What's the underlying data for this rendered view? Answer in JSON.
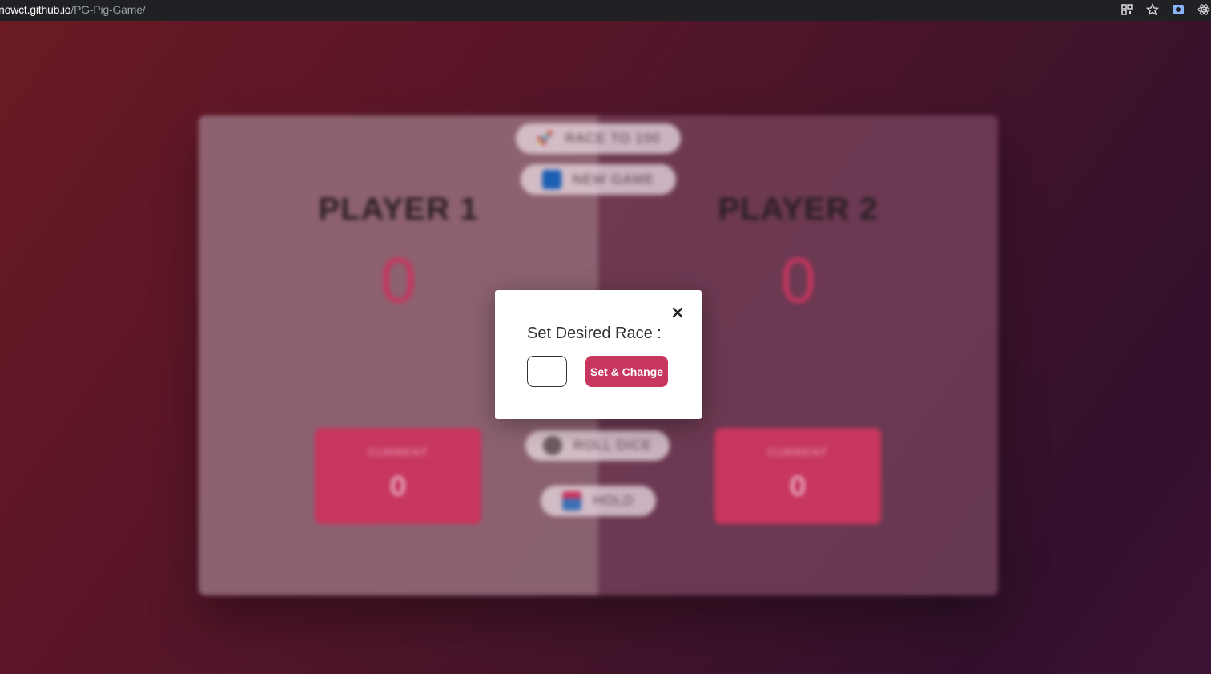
{
  "browser": {
    "url_host": "nowct.github.io",
    "url_path": "/PG-Pig-Game/",
    "icons": [
      "qr-code-icon",
      "bookmark-star-icon",
      "screen-capture-icon",
      "react-devtools-icon"
    ]
  },
  "game": {
    "race_button_label": "RACE TO 100",
    "new_game_label": "NEW GAME",
    "roll_dice_label": "ROLL DICE",
    "hold_label": "HOLD",
    "player1": {
      "name": "PLAYER 1",
      "score": "0",
      "current_label": "CURRENT",
      "current_score": "0"
    },
    "player2": {
      "name": "PLAYER 2",
      "score": "0",
      "current_label": "CURRENT",
      "current_score": "0"
    }
  },
  "modal": {
    "title": "Set Desired Race :",
    "input_value": "",
    "set_button_label": "Set & Change",
    "close_label": "×"
  },
  "colors": {
    "accent": "#c7365f",
    "browser_bar": "#202124"
  }
}
